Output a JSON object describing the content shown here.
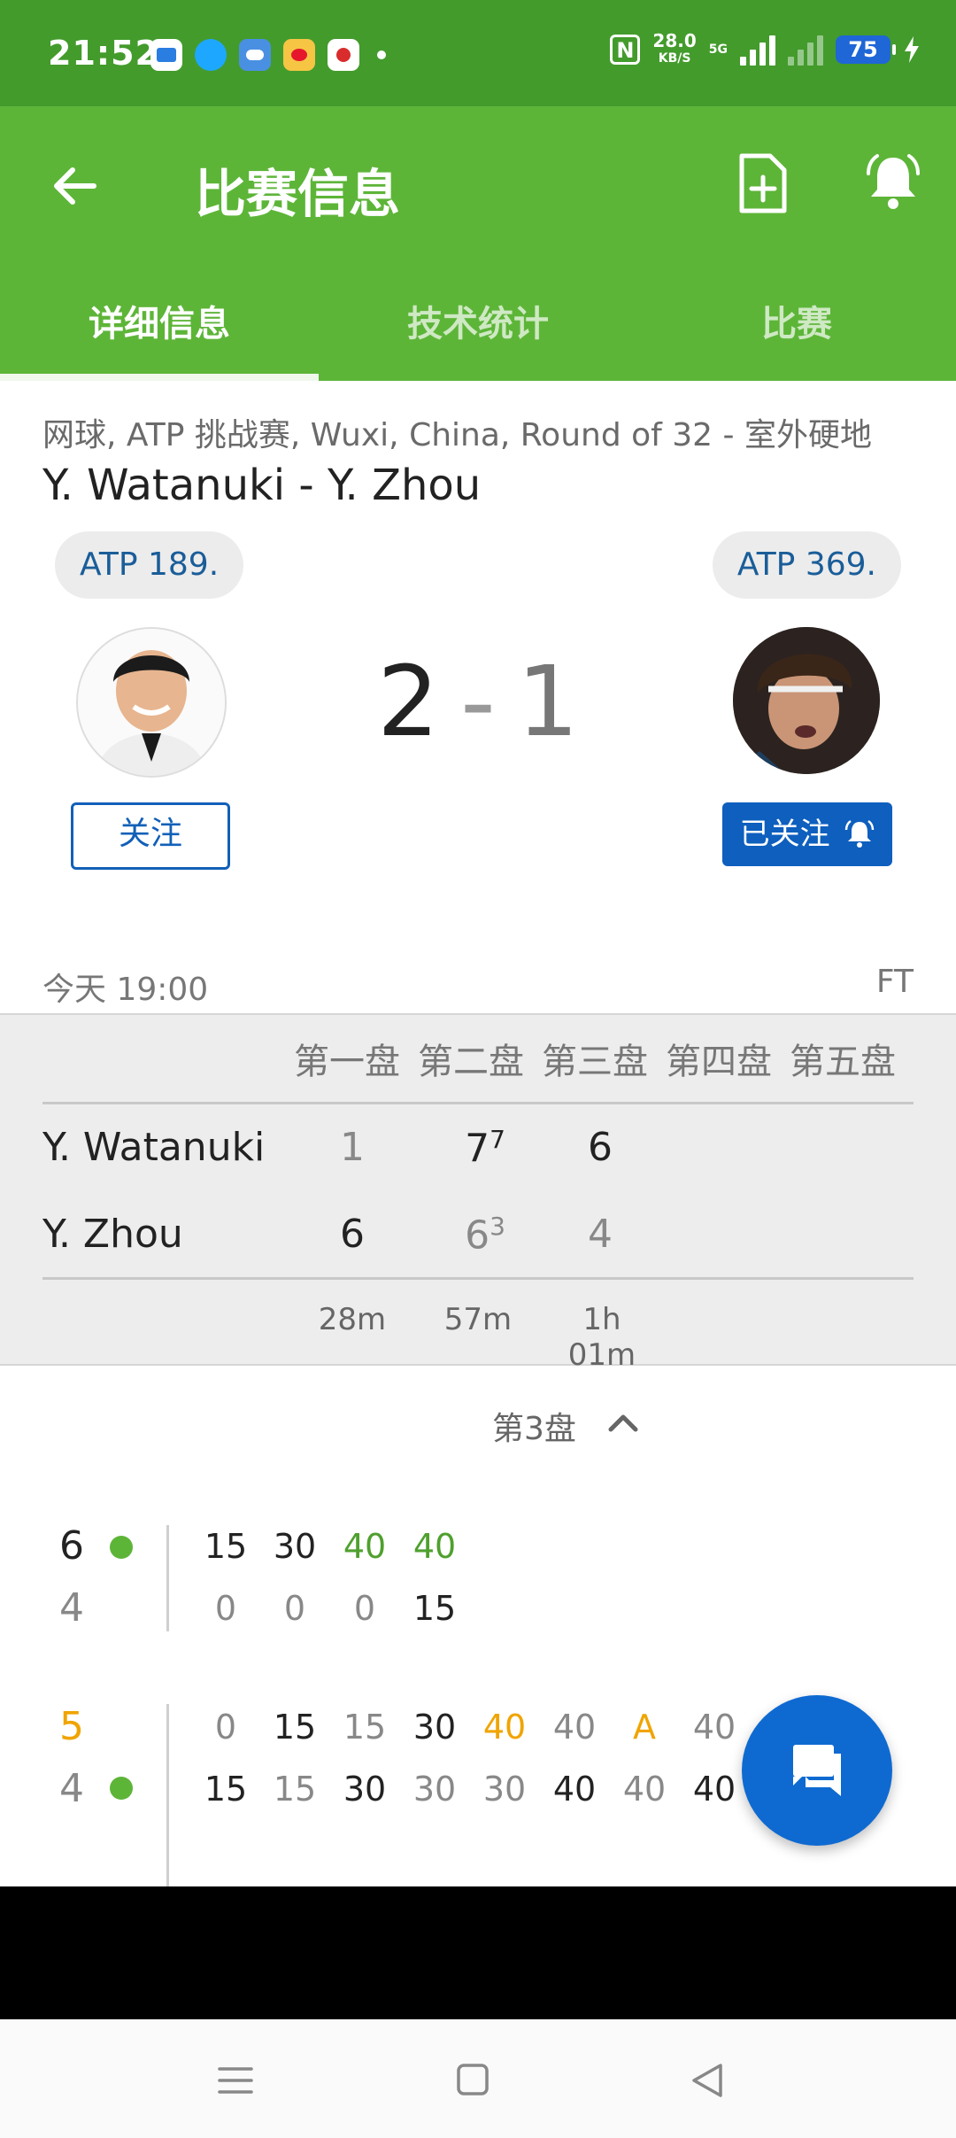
{
  "status_bar": {
    "time": "21:52",
    "net_speed": "28.0",
    "net_unit": "KB/S",
    "net_type": "5G",
    "battery": "75",
    "icons": [
      "app-blue-icon",
      "qq-icon",
      "weather-icon",
      "weibo-icon",
      "news-icon",
      "nfc-icon",
      "signal-icon",
      "charging-icon"
    ]
  },
  "appbar": {
    "title": "比赛信息",
    "colors": {
      "header": "#5db538",
      "status": "#439b2c",
      "accent": "#0e5fbe"
    }
  },
  "tabs": [
    {
      "label": "详细信息",
      "active": true
    },
    {
      "label": "技术统计",
      "active": false
    },
    {
      "label": "比赛",
      "active": false
    }
  ],
  "match": {
    "meta": "网球, ATP 挑战赛, Wuxi, China, Round of 32 - 室外硬地",
    "players_title": "Y. Watanuki - Y. Zhou",
    "home": {
      "rank": "ATP 189.",
      "follow_label": "关注"
    },
    "away": {
      "rank": "ATP 369.",
      "follow_label": "已关注"
    },
    "score_home": "2",
    "score_sep": "-",
    "score_away": "1",
    "time": "今天 19:00",
    "status": "FT"
  },
  "sets": {
    "headers": [
      "第一盘",
      "第二盘",
      "第三盘",
      "第四盘",
      "第五盘"
    ],
    "rows": [
      {
        "name": "Y. Watanuki",
        "s1": "1",
        "s2": "7",
        "s2_tb": "7",
        "s3": "6"
      },
      {
        "name": "Y. Zhou",
        "s1": "6",
        "s2": "6",
        "s2_tb": "3",
        "s3": "4"
      }
    ],
    "durations": [
      "28m",
      "57m",
      "1h 01m"
    ]
  },
  "detail": {
    "set_label": "第3盘",
    "games": [
      {
        "home_games": "6",
        "away_games": "4",
        "home_points": [
          "15",
          "30",
          "40",
          "40"
        ],
        "away_points": [
          "0",
          "0",
          "0",
          "15"
        ]
      },
      {
        "home_games": "5",
        "away_games": "4",
        "home_points": [
          "0",
          "15",
          "15",
          "30",
          "40",
          "40",
          "A",
          "40"
        ],
        "away_points": [
          "15",
          "15",
          "30",
          "30",
          "30",
          "40",
          "40",
          "40"
        ]
      }
    ]
  }
}
